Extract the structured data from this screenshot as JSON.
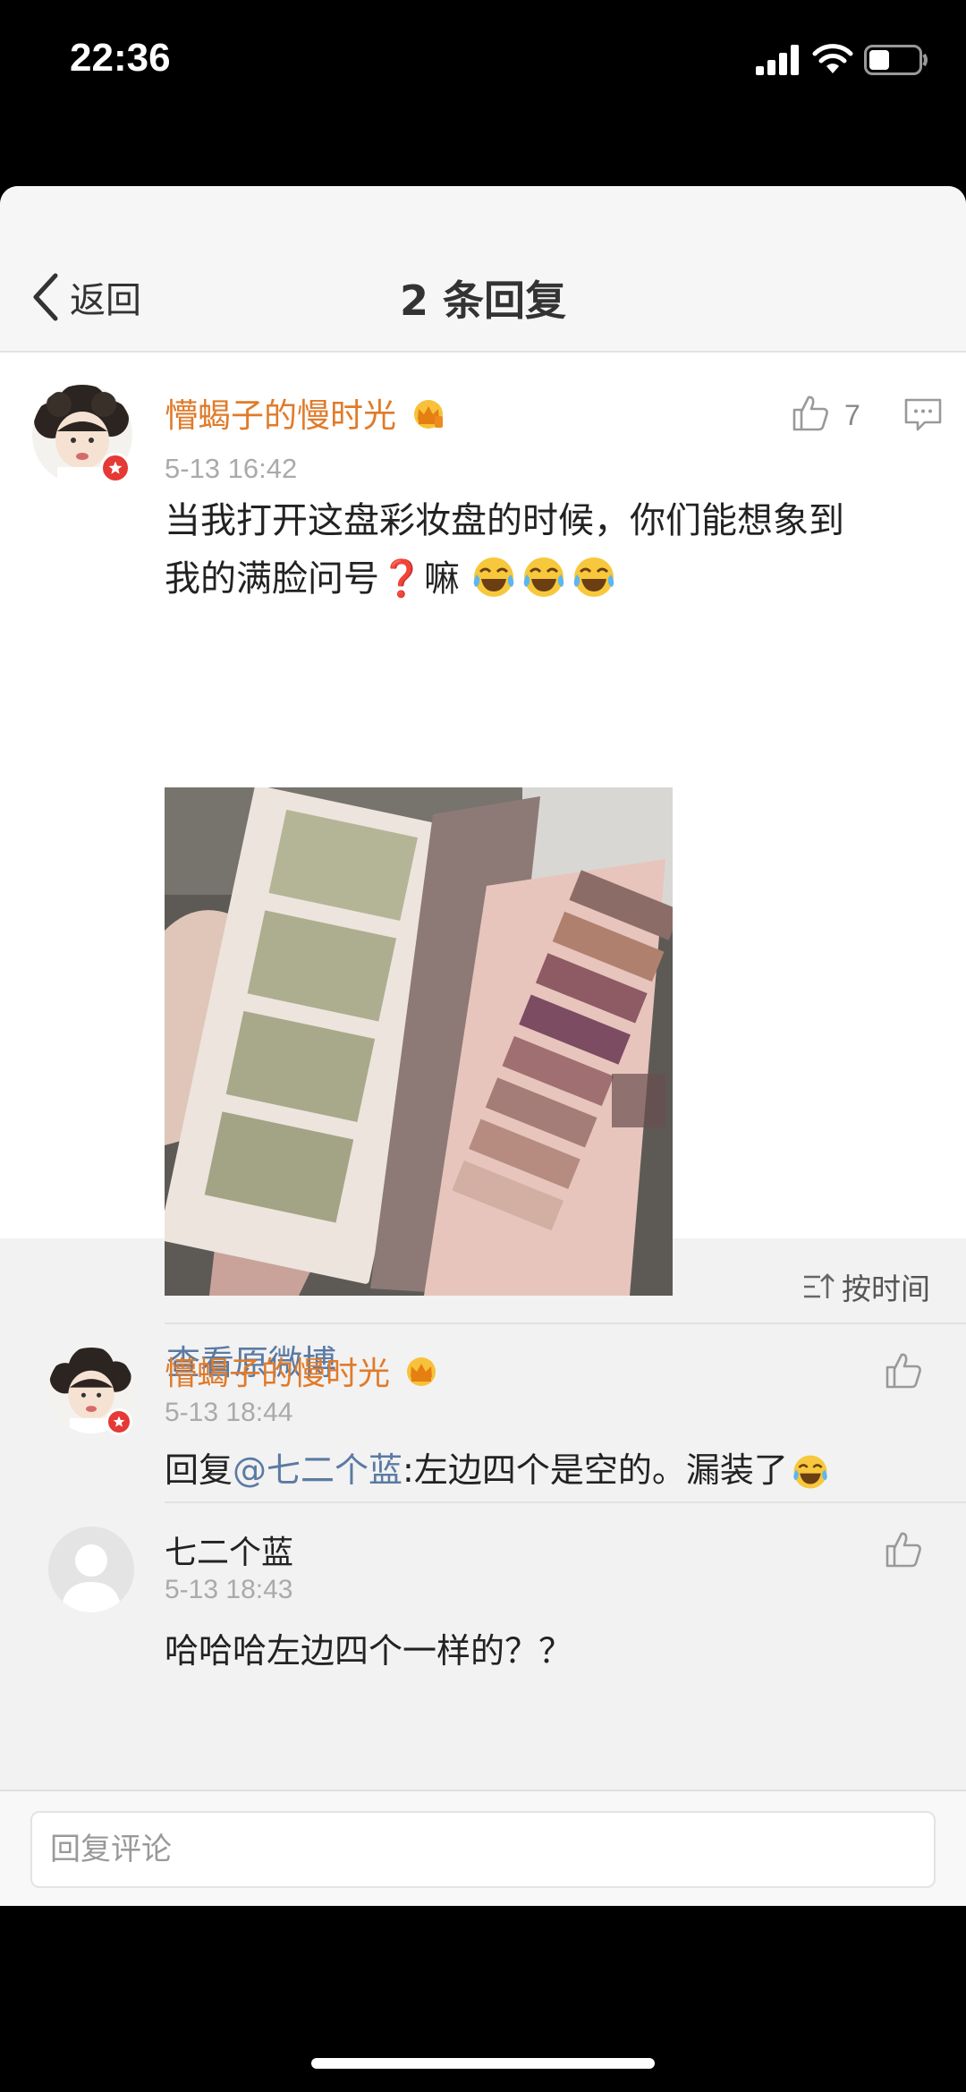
{
  "status_bar": {
    "time": "22:36",
    "signal_icon": "cellular-signal-icon",
    "wifi_icon": "wifi-icon",
    "battery_icon": "battery-icon"
  },
  "nav": {
    "back_label": "返回",
    "title": "2 条回复"
  },
  "main_post": {
    "username": "懵蝎子的慢时光",
    "timestamp": "5-13 16:42",
    "like_count": "7",
    "text_line1": "当我打开这盘彩妆盘的时候，你们能想象到",
    "text_line2_prefix": "我的满脸问号",
    "question_mark": "❓",
    "text_line2_suffix": "嘛",
    "view_original": "查看原微博"
  },
  "sort": {
    "label": "按时间"
  },
  "replies": [
    {
      "username": "懵蝎子的慢时光",
      "timestamp": "5-13 18:44",
      "prefix": "回复",
      "mention": "@七二个蓝",
      "text": ":左边四个是空的。漏装了"
    },
    {
      "username": "七二个蓝",
      "timestamp": "5-13 18:43",
      "text": "哈哈哈左边四个一样的？？"
    }
  ],
  "input": {
    "placeholder": "回复评论"
  },
  "colors": {
    "username": "#e07b2a",
    "link": "#5b7aa3",
    "timestamp": "#aaaaaa",
    "badge": "#e53935"
  }
}
